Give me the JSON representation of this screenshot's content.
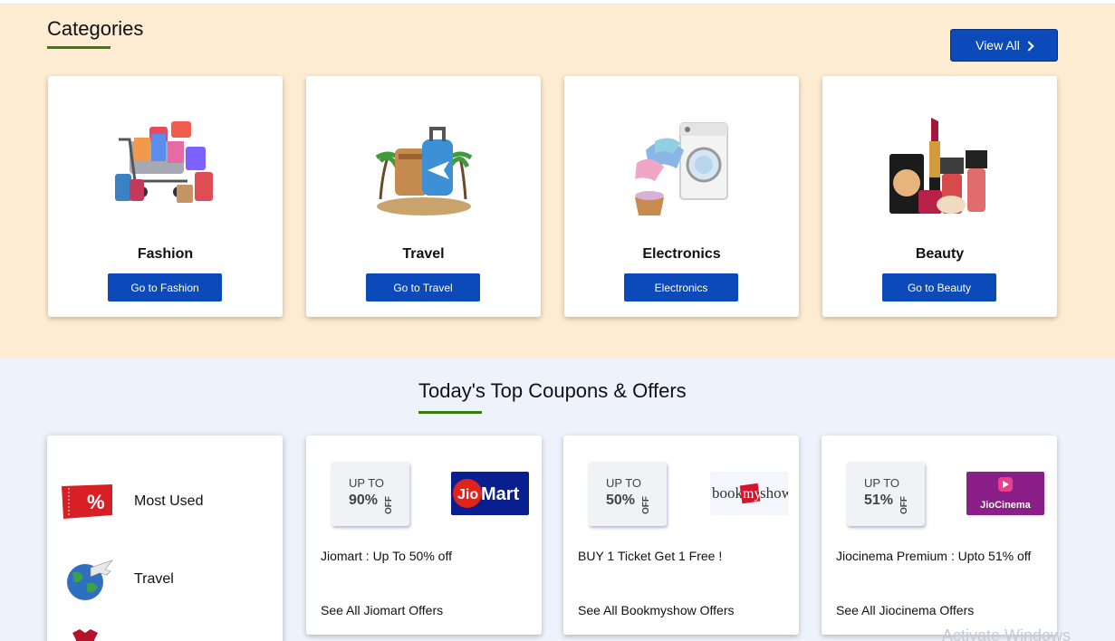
{
  "categories": {
    "title": "Categories",
    "view_all_label": "View All",
    "items": [
      {
        "name": "Fashion",
        "button": "Go to Fashion",
        "icon": "shopping-cart-icon"
      },
      {
        "name": "Travel",
        "button": "Go to Travel",
        "icon": "luggage-icon"
      },
      {
        "name": "Electronics",
        "button": "Electronics",
        "icon": "washing-machine-icon"
      },
      {
        "name": "Beauty",
        "button": "Go to Beauty",
        "icon": "cosmetics-icon"
      }
    ]
  },
  "offers": {
    "title": "Today's Top Coupons & Offers",
    "sidebar": [
      {
        "label": "Most Used",
        "icon": "coupon-icon"
      },
      {
        "label": "Travel",
        "icon": "globe-airplane-icon"
      }
    ],
    "cards": [
      {
        "upto": "UP TO",
        "percent": "90%",
        "off": "OFF",
        "brand": "JioMart",
        "brand_prefix": "Jio",
        "brand_suffix": "Mart",
        "text": "Jiomart : Up To 50% off",
        "link": "See All Jiomart Offers"
      },
      {
        "upto": "UP TO",
        "percent": "50%",
        "off": "OFF",
        "brand": "bookmyshow",
        "brand_prefix": "book",
        "brand_mid": "my",
        "brand_suffix": "show",
        "text": "BUY 1 Ticket Get 1 Free !",
        "link": "See All Bookmyshow Offers"
      },
      {
        "upto": "UP TO",
        "percent": "51%",
        "off": "OFF",
        "brand": "JioCinema",
        "text": "Jiocinema Premium : Upto 51% off",
        "link": "See All Jiocinema Offers"
      }
    ]
  },
  "watermark": "Activate Windows",
  "colors": {
    "accent_blue": "#0b4ab8",
    "underline_green": "#3a7a12",
    "category_bg": "#fdecd2",
    "offers_bg": "#eef2fb"
  }
}
